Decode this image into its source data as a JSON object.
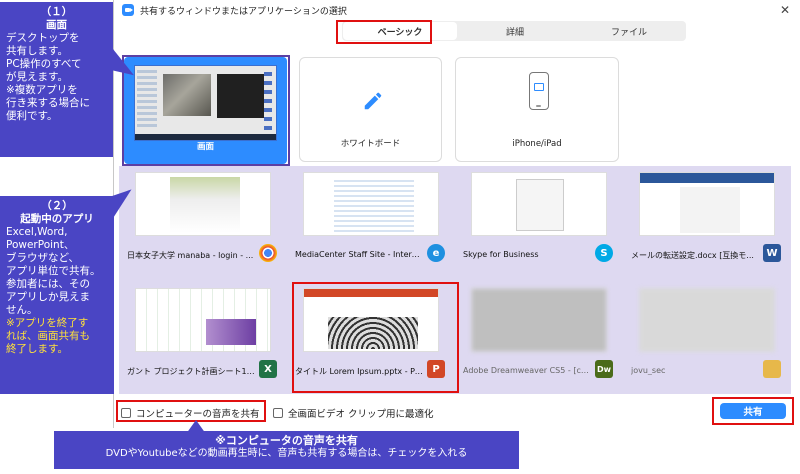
{
  "window": {
    "title": "共有するウィンドウまたはアプリケーションの選択",
    "close_glyph": "✕"
  },
  "tabs": [
    {
      "label": "ベーシック",
      "active": true
    },
    {
      "label": "詳細",
      "active": false
    },
    {
      "label": "ファイル",
      "active": false
    }
  ],
  "top_tiles": {
    "screen": "画面",
    "whiteboard": "ホワイトボード",
    "iphone": "iPhone/iPad"
  },
  "apps": [
    {
      "label": "日本女子大学 manaba - login - ...",
      "icon": "chrome-icon",
      "badge_color": "#4285f4",
      "badge_text": ""
    },
    {
      "label": "MediaCenter Staff Site - Internet ...",
      "icon": "ie-icon",
      "badge_color": "#1e90e0",
      "badge_text": "e"
    },
    {
      "label": "Skype for Business",
      "icon": "skype-icon",
      "badge_color": "#00a9e6",
      "badge_text": "S"
    },
    {
      "label": "メールの転送設定.docx [互換モ...",
      "icon": "word-icon",
      "badge_color": "#2b579a",
      "badge_text": "W"
    },
    {
      "label": "ガント プロジェクト計画シート1 - Ex...",
      "icon": "excel-icon",
      "badge_color": "#217346",
      "badge_text": "X"
    },
    {
      "label": "タイトル Lorem Ipsum.pptx - Pow...",
      "icon": "powerpoint-icon",
      "badge_color": "#d24726",
      "badge_text": "P"
    },
    {
      "label": "Adobe Dreamweaver CS5 - [cont...",
      "icon": "dreamweaver-icon",
      "badge_color": "#4a6b1a",
      "badge_text": "Dw"
    },
    {
      "label": "jovu_sec",
      "icon": "folder-icon",
      "badge_color": "#e7b84a",
      "badge_text": ""
    }
  ],
  "bottom": {
    "audio_checkbox": "コンピューターの音声を共有",
    "fullscreen_checkbox": "全画面ビデオ クリップ用に最適化",
    "share_button": "共有"
  },
  "callouts": {
    "c1": {
      "title": "（１）",
      "subtitle": "画面",
      "lines": [
        "デスクトップを",
        "共有します。",
        "PC操作のすべて",
        "が見えます。",
        "※複数アプリを",
        "行き来する場合に",
        "便利です。"
      ]
    },
    "c2": {
      "title": "（２）",
      "subtitle": "起動中のアプリ",
      "lines": [
        "Excel,Word,",
        "PowerPoint、",
        "ブラウザなど、",
        "アプリ単位で共有。",
        "参加者には、その",
        "アプリしか見えま",
        "せん。"
      ],
      "yellow_lines": [
        "※アプリを終了す",
        "れば、画面共有も",
        "終了します。"
      ]
    },
    "c3": {
      "title": "※コンピュータの音声を共有",
      "body": "DVDやYoutubeなどの動画再生時に、音声も共有する場合は、チェックを入れる"
    }
  }
}
